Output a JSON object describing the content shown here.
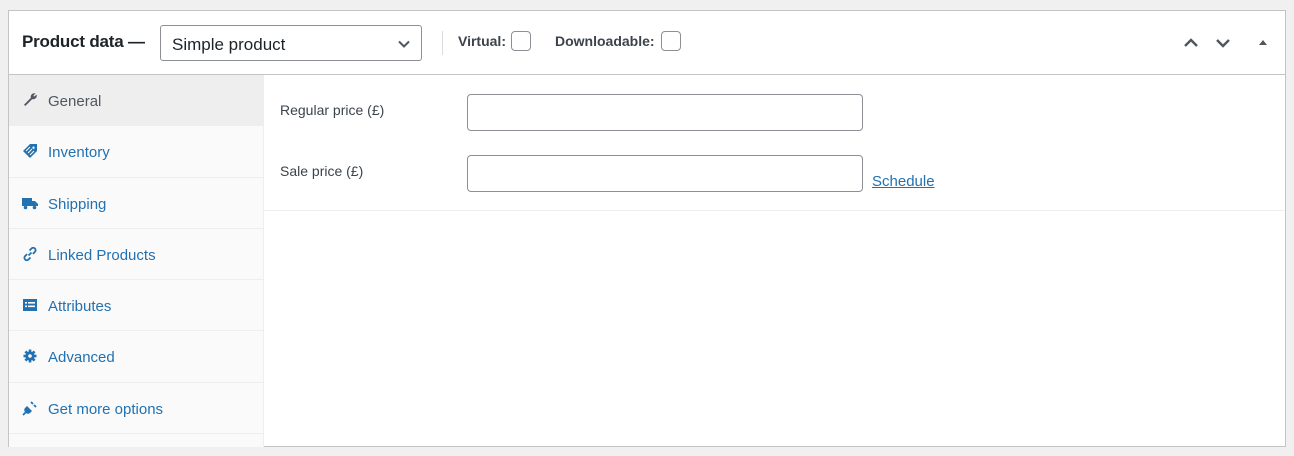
{
  "header": {
    "title": "Product data —",
    "product_type": {
      "selected": "Simple product"
    },
    "virtual_label": "Virtual:",
    "downloadable_label": "Downloadable:",
    "virtual_checked": false,
    "downloadable_checked": false
  },
  "tabs": [
    {
      "label": "General",
      "icon": "wrench-icon",
      "active": true
    },
    {
      "label": "Inventory",
      "icon": "tag-icon",
      "active": false
    },
    {
      "label": "Shipping",
      "icon": "truck-icon",
      "active": false
    },
    {
      "label": "Linked Products",
      "icon": "link-icon",
      "active": false
    },
    {
      "label": "Attributes",
      "icon": "list-icon",
      "active": false
    },
    {
      "label": "Advanced",
      "icon": "gear-icon",
      "active": false
    },
    {
      "label": "Get more options",
      "icon": "plugin-icon",
      "active": false
    }
  ],
  "general": {
    "regular_price_label": "Regular price (£)",
    "regular_price_value": "",
    "sale_price_label": "Sale price (£)",
    "sale_price_value": "",
    "schedule_link": "Schedule"
  },
  "colors": {
    "link": "#2271b1",
    "border": "#c3c4c7",
    "background": "#f0f0f1"
  }
}
